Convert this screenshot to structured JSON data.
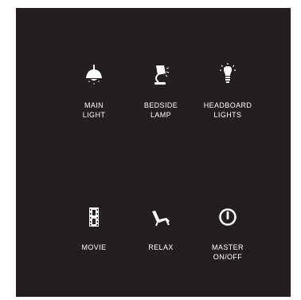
{
  "panel": {
    "background": "#231f20",
    "text_color": "#ffffff",
    "buttons": [
      {
        "label": "MAIN\nLIGHT",
        "icon": "pendant-lamp-icon"
      },
      {
        "label": "BEDSIDE\nLAMP",
        "icon": "desk-lamp-icon"
      },
      {
        "label": "HEADBOARD\nLIGHTS",
        "icon": "light-bulb-icon"
      },
      {
        "label": "MOVIE",
        "icon": "film-strip-icon"
      },
      {
        "label": "RELAX",
        "icon": "lounge-chair-icon"
      },
      {
        "label": "MASTER\nON/OFF",
        "icon": "power-icon"
      }
    ]
  }
}
